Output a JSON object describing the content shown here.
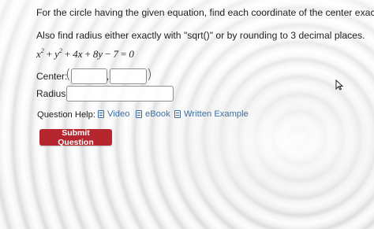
{
  "question": {
    "line1": "For the circle having the given equation, find each coordinate of the center exactly.",
    "line2": "Also find radius either exactly with \"sqrt()\" or by rounding to 3 decimal places.",
    "equation": {
      "x": "x",
      "y": "y",
      "exp": "2",
      "plus1": "+",
      "plus2": "+",
      "term3": "4x",
      "plus3": "+",
      "term4": "8y",
      "minus": "−",
      "const": "7",
      "eq": "=",
      "rhs": "0"
    }
  },
  "answer": {
    "center_label": "Center:",
    "open_paren": "(",
    "comma": ",",
    "close_paren": ")",
    "center_x_value": "",
    "center_y_value": "",
    "radius_label": "Radius:",
    "radius_value": ""
  },
  "help": {
    "label": "Question Help:",
    "links": [
      {
        "label": "Video",
        "icon": "document-icon"
      },
      {
        "label": "eBook",
        "icon": "document-icon"
      },
      {
        "label": "Written Example",
        "icon": "document-icon"
      }
    ]
  },
  "submit": {
    "label": "Submit Question",
    "color": "#b5262f"
  },
  "colors": {
    "link": "#3d6fa6"
  }
}
